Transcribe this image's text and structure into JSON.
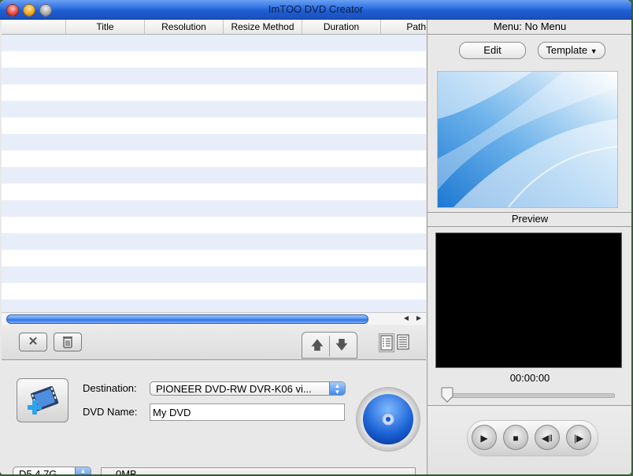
{
  "window": {
    "title": "ImTOO DVD Creator"
  },
  "file_list": {
    "columns": [
      "",
      "Title",
      "Resolution",
      "Resize Method",
      "Duration",
      "Path"
    ],
    "rows": []
  },
  "toolbar": {
    "remove_icon": "x-icon",
    "delete_icon": "trash-icon",
    "move_up_icon": "arrow-up-icon",
    "move_down_icon": "arrow-down-icon",
    "detail_view_icon": "detail-list-icon",
    "list_view_icon": "list-icon"
  },
  "output": {
    "destination_label": "Destination:",
    "destination_value": "PIONEER DVD-RW  DVR-K06 vi...",
    "dvd_name_label": "DVD Name:",
    "dvd_name_value": "My DVD",
    "disc_type": "D5 4.7G",
    "size_used": "0MB"
  },
  "menu_panel": {
    "header": "Menu:  No Menu",
    "edit_label": "Edit",
    "template_label": "Template"
  },
  "preview_panel": {
    "header": "Preview",
    "timecode": "00:00:00",
    "position_fraction": 0
  },
  "player": {
    "buttons": [
      "play",
      "stop",
      "step-back",
      "step-forward"
    ]
  }
}
